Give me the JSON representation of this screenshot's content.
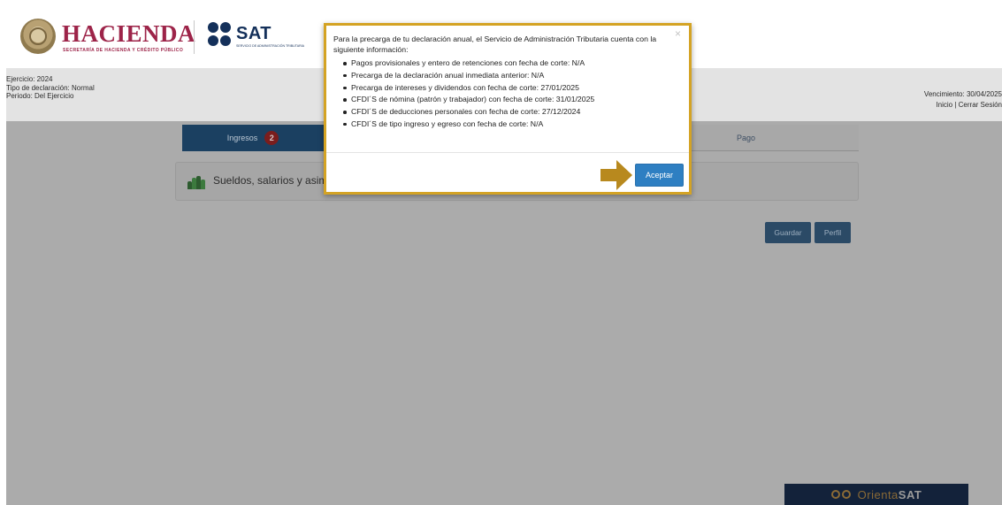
{
  "header": {
    "hacienda_word": "HACIENDA",
    "hacienda_sub": "SECRETARÍA DE HACIENDA Y CRÉDITO PÚBLICO",
    "sat_word": "SAT",
    "sat_sub": "SERVICIO DE ADMINISTRACIÓN TRIBUTARIA"
  },
  "info": {
    "ejercicio": "Ejercicio: 2024",
    "tipo": "Tipo de declaración: Normal",
    "periodo": "Periodo: Del Ejercicio",
    "vencimiento": "Vencimiento: 30/04/2025",
    "inicio": "Inicio",
    "separator": " | ",
    "cerrar": "Cerrar Sesión"
  },
  "tabs": {
    "ingresos_label": "Ingresos",
    "ingresos_badge": "2",
    "pago_label": "Pago"
  },
  "section": {
    "title": "Sueldos, salarios y asimi"
  },
  "actions": {
    "guardar": "Guardar",
    "perfil": "Perfil"
  },
  "orienta": {
    "prefix": "Orienta",
    "suffix": "SAT"
  },
  "modal": {
    "close": "×",
    "intro": "Para la precarga de tu declaración anual, el Servicio de Administración Tributaria cuenta con la siguiente información:",
    "items": [
      "Pagos provisionales y entero de retenciones con fecha de corte: N/A",
      "Precarga de la declaración anual inmediata anterior: N/A",
      "Precarga de intereses y dividendos con fecha de corte: 27/01/2025",
      "CFDI´S de nómina (patrón y trabajador) con fecha de corte: 31/01/2025",
      "CFDI´S de deducciones personales con fecha de corte: 27/12/2024",
      "CFDI´S de tipo ingreso y egreso con fecha de corte: N/A"
    ],
    "accept": "Aceptar"
  },
  "colors": {
    "modal_border": "#d4a324",
    "accept_button": "#2e7fc2",
    "arrow": "#b8891e",
    "hacienda": "#9d2449",
    "sat": "#14305a"
  }
}
